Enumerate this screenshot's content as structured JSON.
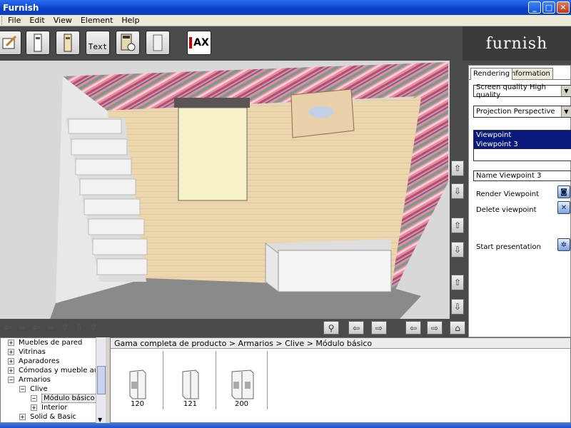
{
  "window": {
    "title": "Furnish"
  },
  "menu": [
    "File",
    "Edit",
    "View",
    "Element",
    "Help"
  ],
  "toolbar": {
    "buttons": [
      {
        "name": "edit-icon",
        "label": ""
      },
      {
        "name": "door-icon",
        "label": ""
      },
      {
        "name": "door-light-icon",
        "label": ""
      },
      {
        "name": "text-tool-icon",
        "label": "Text"
      },
      {
        "name": "cabinet-icon",
        "label": ""
      },
      {
        "name": "panel-icon",
        "label": ""
      }
    ],
    "ax_label": "AX",
    "logo": "furnish"
  },
  "panel": {
    "tabs": [
      "Rendering",
      "Information"
    ],
    "screen_quality": "Screen quality   High quality",
    "projection": "Projection   Perspective",
    "viewpoint_list": [
      "Viewpoint",
      "Viewpoint 3"
    ],
    "name_field": "Name Viewpoint 3",
    "render_viewpoint": "Render Viewpoint",
    "delete_viewpoint": "Delete viewpoint",
    "start_presentation": "Start presentation"
  },
  "tree": {
    "items": [
      {
        "label": "Muebles de pared",
        "sign": "+",
        "level": 0
      },
      {
        "label": "Vitrinas",
        "sign": "+",
        "level": 0
      },
      {
        "label": "Aparadores",
        "sign": "+",
        "level": 0
      },
      {
        "label": "Cómodas y mueble auxiliar",
        "sign": "+",
        "level": 0
      },
      {
        "label": "Armarios",
        "sign": "−",
        "level": 0
      },
      {
        "label": "Clive",
        "sign": "−",
        "level": 1
      },
      {
        "label": "Módulo básico",
        "sign": "−",
        "level": 2
      },
      {
        "label": "Interior",
        "sign": "+",
        "level": 2
      },
      {
        "label": "Solid & Basic",
        "sign": "+",
        "level": 1
      }
    ]
  },
  "catalog": {
    "breadcrumb": "Gama completa de producto > Armarios > Clive > Módulo básico",
    "products": [
      {
        "label": "120"
      },
      {
        "label": "121"
      },
      {
        "label": "200"
      }
    ]
  },
  "colors": {
    "accent": "#0a1a7a",
    "toolbar": "#4a4a4a",
    "stripe_pink": "#e07090",
    "floor": "#e8d2ac"
  }
}
